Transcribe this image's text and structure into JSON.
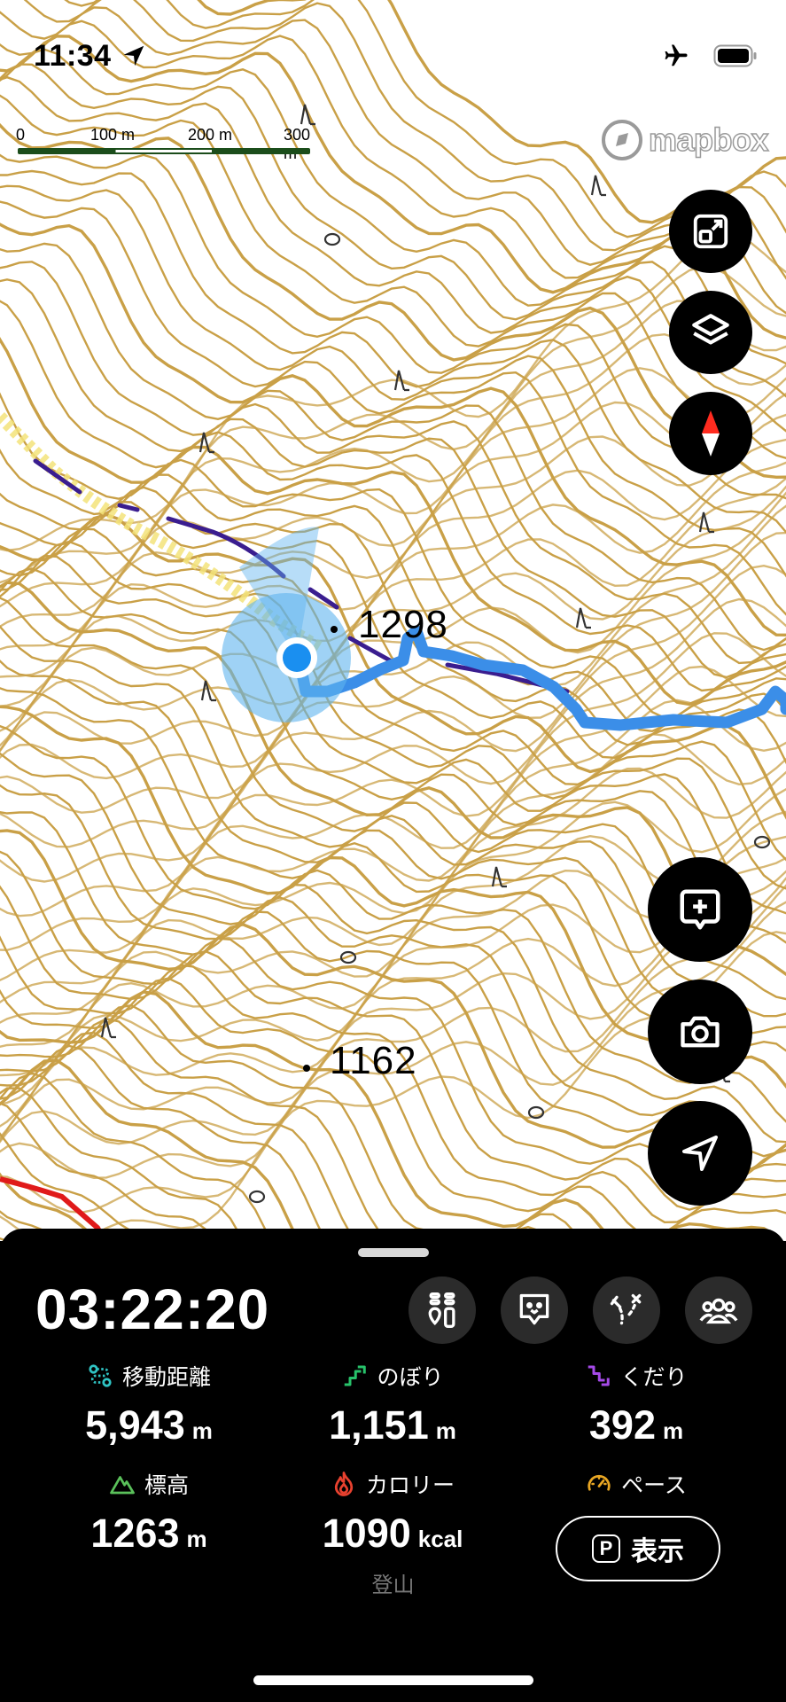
{
  "status_bar": {
    "time": "11:34",
    "icons": [
      "location-arrow-icon",
      "airplane-icon",
      "battery-icon"
    ]
  },
  "map": {
    "scale_labels": [
      "0",
      "100 m",
      "200 m",
      "300 m"
    ],
    "attribution": "mapbox",
    "spot_heights": [
      "1298",
      "1162"
    ],
    "colors": {
      "contour": "#c9a047",
      "track": "#3b8ee8",
      "trail": "#3a1d8f",
      "road": "#e01a1a",
      "accuracy": "#5fb4ef"
    }
  },
  "map_controls": {
    "top": [
      "fullscreen-toggle-icon",
      "layers-icon",
      "compass-icon"
    ],
    "bottom": [
      "add-memo-icon",
      "camera-icon",
      "navigate-arrow-icon"
    ]
  },
  "panel": {
    "timer": "03:22:20",
    "tools": [
      "checkpoint-icon",
      "bear-alert-icon",
      "route-icon",
      "group-icon"
    ],
    "stats": [
      {
        "label": "移動距離",
        "value": "5,943",
        "unit": "m",
        "icon": "distance-icon",
        "color": "#2fc4c4"
      },
      {
        "label": "のぼり",
        "value": "1,151",
        "unit": "m",
        "icon": "ascent-icon",
        "color": "#27c26a"
      },
      {
        "label": "くだり",
        "value": "392",
        "unit": "m",
        "icon": "descent-icon",
        "color": "#a54ae8"
      },
      {
        "label": "標高",
        "value": "1263",
        "unit": "m",
        "icon": "mountain-icon",
        "color": "#5ac05a"
      },
      {
        "label": "カロリー",
        "value": "1090",
        "unit": "kcal",
        "icon": "flame-icon",
        "color": "#e8412f"
      },
      {
        "label": "ペース",
        "icon": "speedometer-icon",
        "color": "#e8a623"
      }
    ],
    "activity_type": "登山",
    "show_button": {
      "badge": "P",
      "label": "表示"
    }
  }
}
